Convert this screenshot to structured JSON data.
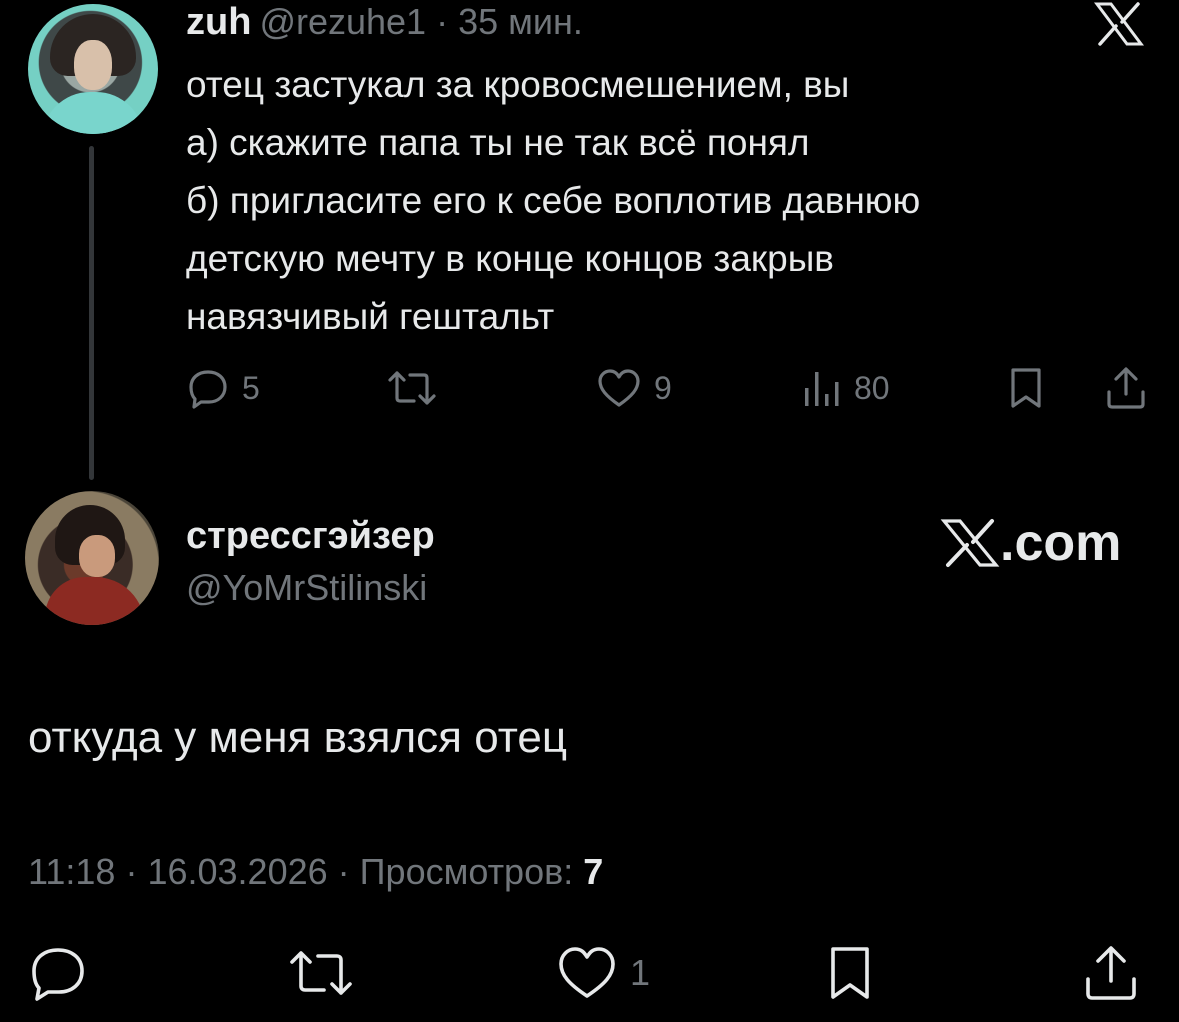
{
  "top_tweet": {
    "display_name": "zuh",
    "handle": "@rezuhe1",
    "separator": "·",
    "time": "35 мин.",
    "lines": [
      "отец застукал за кровосмешением, вы",
      "а) скажите папа ты не так всё понял",
      "б) пригласите его к себе воплотив давнюю",
      "детскую мечту в конце концов закрыв",
      "навязчивый гештальт"
    ],
    "actions": {
      "replies": "5",
      "retweets": "",
      "likes": "9",
      "views": "80"
    },
    "icons": [
      "x-logo-icon",
      "reply-icon",
      "retweet-icon",
      "heart-icon",
      "views-icon",
      "bookmark-icon",
      "share-icon"
    ]
  },
  "main_tweet": {
    "display_name": "стрессгэйзер",
    "handle": "@YoMrStilinski",
    "brand": ".com",
    "text": "откуда у меня взялся отец",
    "meta": {
      "time": "11:18",
      "date": "16.03.2026",
      "separator": "·",
      "views_label": "Просмотров:",
      "views_count": "7"
    },
    "actions": {
      "likes": "1"
    },
    "icons": [
      "reply-icon",
      "retweet-icon",
      "heart-icon",
      "bookmark-icon",
      "share-icon"
    ]
  },
  "colors": {
    "background": "#000000",
    "text": "#e7e9ea",
    "muted": "#71767b",
    "thread_line": "#333639"
  }
}
